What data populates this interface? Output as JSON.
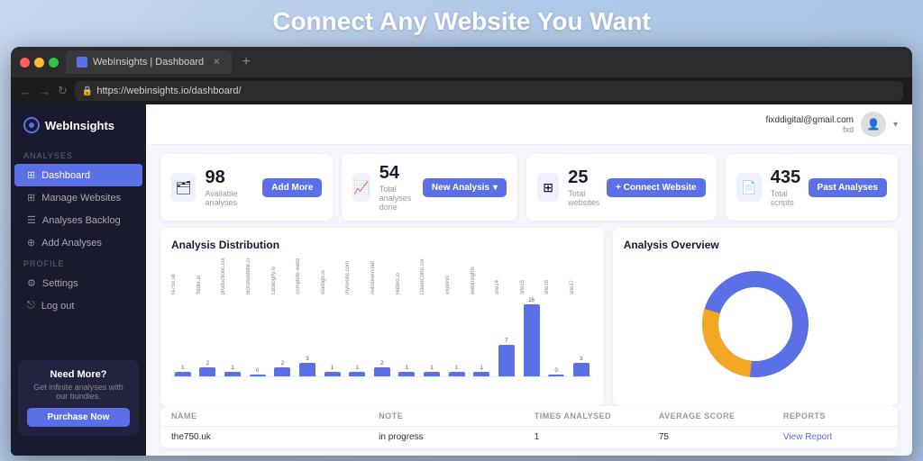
{
  "hero": {
    "title": "Connect Any Website You Want"
  },
  "browser": {
    "tab_label": "WebInsights | Dashboard",
    "url": "https://webinsights.io/dashboard/",
    "new_tab_symbol": "+"
  },
  "sidebar": {
    "logo_text": "WebInsights",
    "sections": [
      {
        "label": "ANALYSES",
        "items": [
          {
            "id": "dashboard",
            "label": "Dashboard",
            "icon": "⊞",
            "active": true
          },
          {
            "id": "manage-websites",
            "label": "Manage Websites",
            "icon": "⊞",
            "active": false
          },
          {
            "id": "analyses-backlog",
            "label": "Analyses Backlog",
            "icon": "☰",
            "active": false
          },
          {
            "id": "add-analyses",
            "label": "Add Analyses",
            "icon": "⊕",
            "active": false
          }
        ]
      },
      {
        "label": "PROFILE",
        "items": [
          {
            "id": "settings",
            "label": "Settings",
            "icon": "⚙",
            "active": false
          },
          {
            "id": "log-out",
            "label": "Log out",
            "icon": "⎋",
            "active": false
          }
        ]
      }
    ],
    "need_more_card": {
      "title": "Need More?",
      "subtitle": "Get infinite analyses with our bundles.",
      "button_label": "Purchase Now"
    }
  },
  "header": {
    "user_email": "fixddigital@gmail.com",
    "user_name": "fxd"
  },
  "stats": [
    {
      "id": "available-analyses",
      "number": "98",
      "label": "Available analyses",
      "button_label": "Add More",
      "button_icon": "⊞"
    },
    {
      "id": "total-analyses-done",
      "number": "54",
      "label": "Total analyses done",
      "button_label": "New Analysis",
      "button_icon": "↗"
    },
    {
      "id": "total-websites",
      "number": "25",
      "label": "Total websites",
      "button_label": "+ Connect Website",
      "button_icon": "+"
    },
    {
      "id": "total-scripts",
      "number": "435",
      "label": "Total scripts",
      "button_label": "Past Analyses",
      "button_icon": "👁"
    }
  ],
  "analysis_distribution": {
    "title": "Analysis Distribution",
    "bars": [
      {
        "label": "ra750.uk",
        "value": 1
      },
      {
        "label": "fiddle.ai",
        "value": 2
      },
      {
        "label": "productionc.com",
        "value": 1
      },
      {
        "label": "nickshostelle.com",
        "value": 0
      },
      {
        "label": "catalogify.io",
        "value": 2
      },
      {
        "label": "complete-websites.com",
        "value": 3
      },
      {
        "label": "dialsign.io",
        "value": 1
      },
      {
        "label": "myovons.com",
        "value": 1
      },
      {
        "label": "nolosewin.net",
        "value": 2
      },
      {
        "label": "Hetero.io",
        "value": 1
      },
      {
        "label": "DawnCorte.com",
        "value": 1
      },
      {
        "label": "express",
        "value": 1
      },
      {
        "label": "webinsights",
        "value": 1
      },
      {
        "label": "site14",
        "value": 7
      },
      {
        "label": "site15",
        "value": 16
      },
      {
        "label": "site16",
        "value": 0
      },
      {
        "label": "site17",
        "value": 3
      }
    ]
  },
  "analysis_overview": {
    "title": "Analysis Overview",
    "donut": {
      "blue_pct": 72,
      "orange_pct": 28
    }
  },
  "table": {
    "headers": [
      "NAME",
      "NOTE",
      "TIMES ANALYSED",
      "AVERAGE SCORE",
      "REPORTS"
    ],
    "rows": [
      {
        "name": "the750.uk",
        "note": "in progress",
        "times_analysed": "1",
        "average_score": "75",
        "reports_link": "View Report"
      }
    ]
  }
}
